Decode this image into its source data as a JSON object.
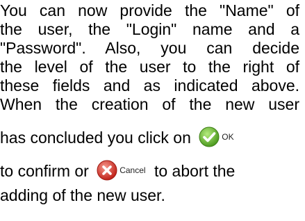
{
  "paragraph": {
    "line1": "You can now provide the \"Name\" of",
    "line2": "the user, the \"Login\" name and a",
    "line3": "\"Password\". Also, you can decide",
    "line4": "the level of the user to the right of",
    "line5": "these fields and as indicated above.",
    "line6": "When the creation of the new user",
    "line7": "has concluded you click on",
    "line8_a": "to confirm or",
    "line8_b": "to abort the",
    "line9": "adding of the new user."
  },
  "ok_button": {
    "label": "OK",
    "icon": "check-icon",
    "color": "#6fbf3a"
  },
  "cancel_button": {
    "label": "Cancel",
    "icon": "x-icon",
    "color": "#d9342b"
  }
}
